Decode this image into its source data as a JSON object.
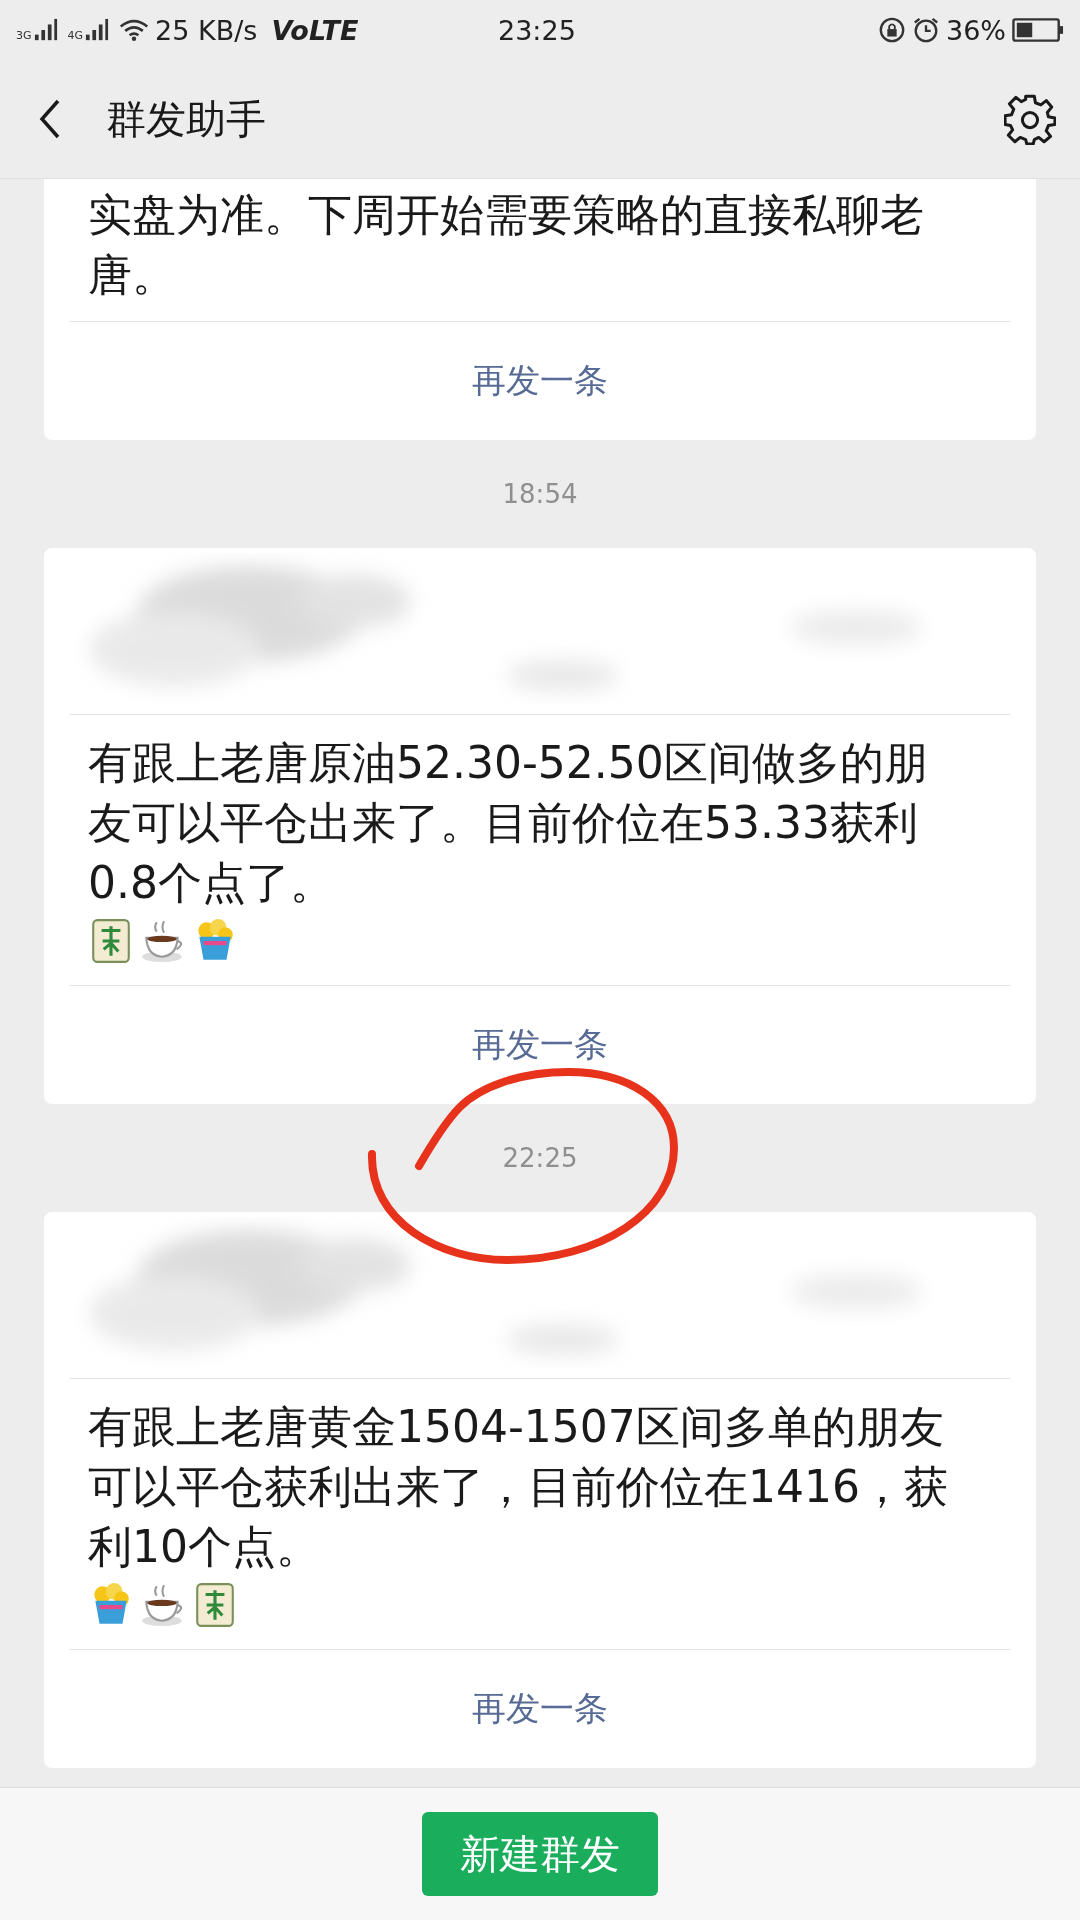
{
  "status_bar": {
    "network_labels": [
      "3G",
      "4G"
    ],
    "speed": "25 KB/s",
    "volte": "VoLTE",
    "time": "23:25",
    "battery": "36%"
  },
  "nav": {
    "title": "群发助手"
  },
  "messages": [
    {
      "header_visible": false,
      "text": "实盘为准。下周开始需要策略的直接私聊老唐。",
      "resend": "再发一条"
    },
    {
      "header_visible": true,
      "timestamp": "18:54",
      "text": "有跟上老唐原油52.30-52.50区间做多的朋友可以平仓出来了。目前价位在53.33获利0.8个点了。",
      "emojis": [
        {
          "kind": "mahjong"
        },
        {
          "kind": "coffee"
        },
        {
          "kind": "cup"
        }
      ],
      "resend": "再发一条"
    },
    {
      "header_visible": true,
      "timestamp": "22:25",
      "text": "有跟上老唐黄金1504-1507区间多单的朋友可以平仓获利出来了，目前价位在1416，获利10个点。",
      "emojis": [
        {
          "kind": "cup"
        },
        {
          "kind": "coffee"
        },
        {
          "kind": "mahjong"
        }
      ],
      "resend": "再发一条"
    }
  ],
  "annotation": {
    "kind": "circle"
  },
  "new_button": "新建群发"
}
